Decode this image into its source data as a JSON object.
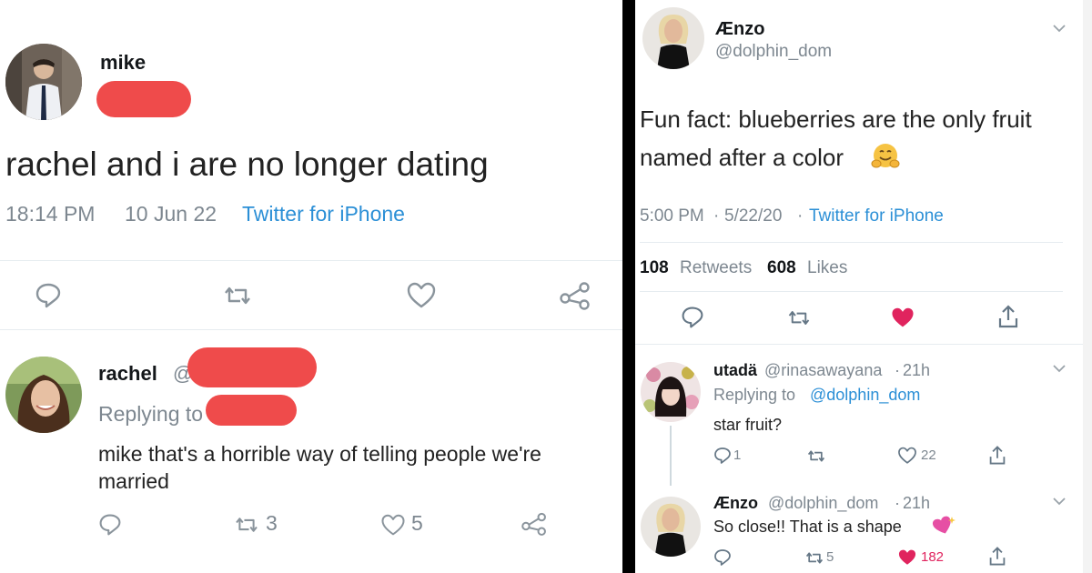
{
  "left": {
    "tweet": {
      "display_name": "mike",
      "text": "rachel and i are no longer dating",
      "time": "18:14 PM",
      "date": "10 Jun 22",
      "source": "Twitter for iPhone",
      "icons": [
        "reply-icon",
        "retweet-icon",
        "heart-outline-icon",
        "share-icon"
      ]
    },
    "reply": {
      "display_name": "rachel",
      "handle_fragment": "@",
      "replying_to": "Replying to",
      "text_line1": "mike that's a horrible way of telling people we're",
      "text_line2": "married",
      "retweets": "3",
      "likes": "5"
    }
  },
  "right": {
    "tweet": {
      "display_name": "Ænzo",
      "handle": "@dolphin_dom",
      "text_line1": "Fun fact: blueberries are the only fruit",
      "text_line2": "named after a color",
      "emoji": "hugging-face-emoji",
      "time": "5:00 PM",
      "date": "5/22/20",
      "source": "Twitter for iPhone",
      "retweet_count": "108",
      "retweet_label": "Retweets",
      "like_count": "608",
      "like_label": "Likes",
      "liked": true
    },
    "replies": [
      {
        "display_name": "utadä",
        "handle": "@rinasawayana",
        "age": "21h",
        "replying_to": "Replying to",
        "replying_handle": "@dolphin_dom",
        "text": "star fruit?",
        "reply_count": "1",
        "retweet_count": "",
        "like_count": "22",
        "liked": false
      },
      {
        "display_name": "Ænzo",
        "handle": "@dolphin_dom",
        "age": "21h",
        "text": "So close!! That is a shape",
        "emoji": "sparkling-heart-emoji",
        "reply_count": "",
        "retweet_count": "5",
        "like_count": "182",
        "liked": true
      }
    ]
  },
  "colors": {
    "link_blue": "#2b8fd6",
    "grey_text": "#7d8790",
    "like_red": "#e0245e",
    "redaction": "#ef4b4b",
    "divider": "#000000"
  }
}
